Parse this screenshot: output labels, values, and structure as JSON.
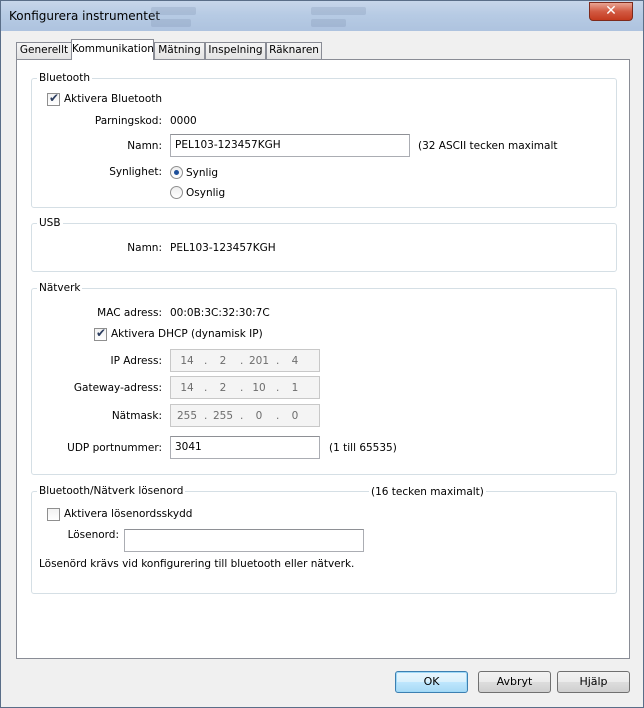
{
  "window": {
    "title": "Konfigurera instrumentet",
    "close_glyph": "✕"
  },
  "tabs": [
    {
      "label": "Generellt",
      "active": false
    },
    {
      "label": "Kommunikation",
      "active": true
    },
    {
      "label": "Mätning",
      "active": false
    },
    {
      "label": "Inspelning",
      "active": false
    },
    {
      "label": "Räknaren",
      "active": false
    }
  ],
  "bluetooth": {
    "title": "Bluetooth",
    "enable_label": "Aktivera Bluetooth",
    "enable_checked": true,
    "pairing_label": "Parningskod:",
    "pairing_value": "0000",
    "name_label": "Namn:",
    "name_value": "PEL103-123457KGH",
    "name_hint": "(32 ASCII tecken maximalt",
    "visibility_label": "Synlighet:",
    "visible_label": "Synlig",
    "visible_checked": true,
    "invisible_label": "Osynlig",
    "invisible_checked": false
  },
  "usb": {
    "title": "USB",
    "name_label": "Namn:",
    "name_value": "PEL103-123457KGH"
  },
  "network": {
    "title": "Nätverk",
    "mac_label": "MAC adress:",
    "mac_value": "00:0B:3C:32:30:7C",
    "dhcp_label": "Aktivera DHCP (dynamisk IP)",
    "dhcp_checked": true,
    "ip_label": "IP Adress:",
    "ip": [
      "14",
      "2",
      "201",
      "4"
    ],
    "gateway_label": "Gateway-adress:",
    "gateway": [
      "14",
      "2",
      "10",
      "1"
    ],
    "mask_label": "Nätmask:",
    "mask": [
      "255",
      "255",
      "0",
      "0"
    ],
    "udp_label": "UDP portnummer:",
    "udp_value": "3041",
    "udp_hint": "(1 till 65535)"
  },
  "password": {
    "title": "Bluetooth/Nätverk lösenord",
    "max_hint": "(16 tecken maximalt)",
    "enable_label": "Aktivera lösenordsskydd",
    "enable_checked": false,
    "field_label": "Lösenord:",
    "field_value": "",
    "note": "Lösenörd krävs vid konfigurering till bluetooth eller nätverk."
  },
  "buttons": {
    "ok": "OK",
    "cancel": "Avbryt",
    "help": "Hjälp"
  },
  "ip_separator": "."
}
